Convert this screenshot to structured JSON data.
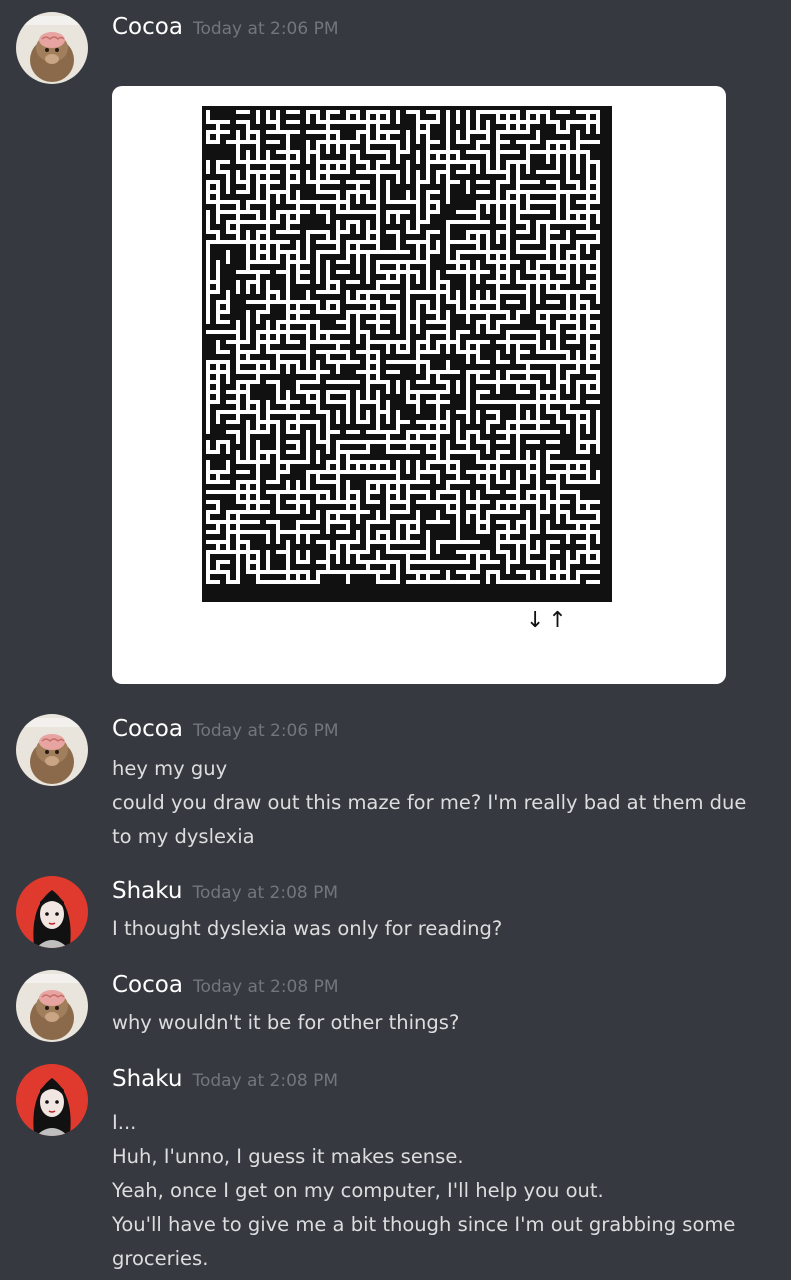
{
  "messages": [
    {
      "author": "Cocoa",
      "timestamp": "Today at 2:06 PM",
      "avatar_icon": "monkey-neuron-activation-avatar",
      "avatar_caption": "neuron activation",
      "attachment": {
        "type": "image",
        "description_icon": "maze-image",
        "arrows": "↓↑"
      }
    },
    {
      "author": "Cocoa",
      "timestamp": "Today at 2:06 PM",
      "avatar_icon": "monkey-neuron-activation-avatar",
      "lines": [
        "hey my guy",
        "could you draw out this maze for me? I'm really bad at them due to my dyslexia"
      ]
    },
    {
      "author": "Shaku",
      "timestamp": "Today at 2:08 PM",
      "avatar_icon": "anime-character-avatar",
      "lines": [
        "I thought dyslexia was only for reading?"
      ]
    },
    {
      "author": "Cocoa",
      "timestamp": "Today at 2:08 PM",
      "avatar_icon": "monkey-neuron-activation-avatar",
      "lines": [
        "why wouldn't it be for other things?"
      ]
    },
    {
      "author": "Shaku",
      "timestamp": "Today at 2:08 PM",
      "avatar_icon": "anime-character-avatar",
      "lines": [
        "I...",
        "Huh, I'unno, I guess it makes sense.",
        "Yeah, once I get on my computer, I'll help you out.",
        "You'll have to give me a bit though since I'm out grabbing some groceries."
      ]
    }
  ],
  "colors": {
    "background": "#36393f",
    "username": "#ffffff",
    "timestamp": "#72767d",
    "message_text": "#dcddde",
    "shaku_avatar_bg": "#e03a2f"
  }
}
